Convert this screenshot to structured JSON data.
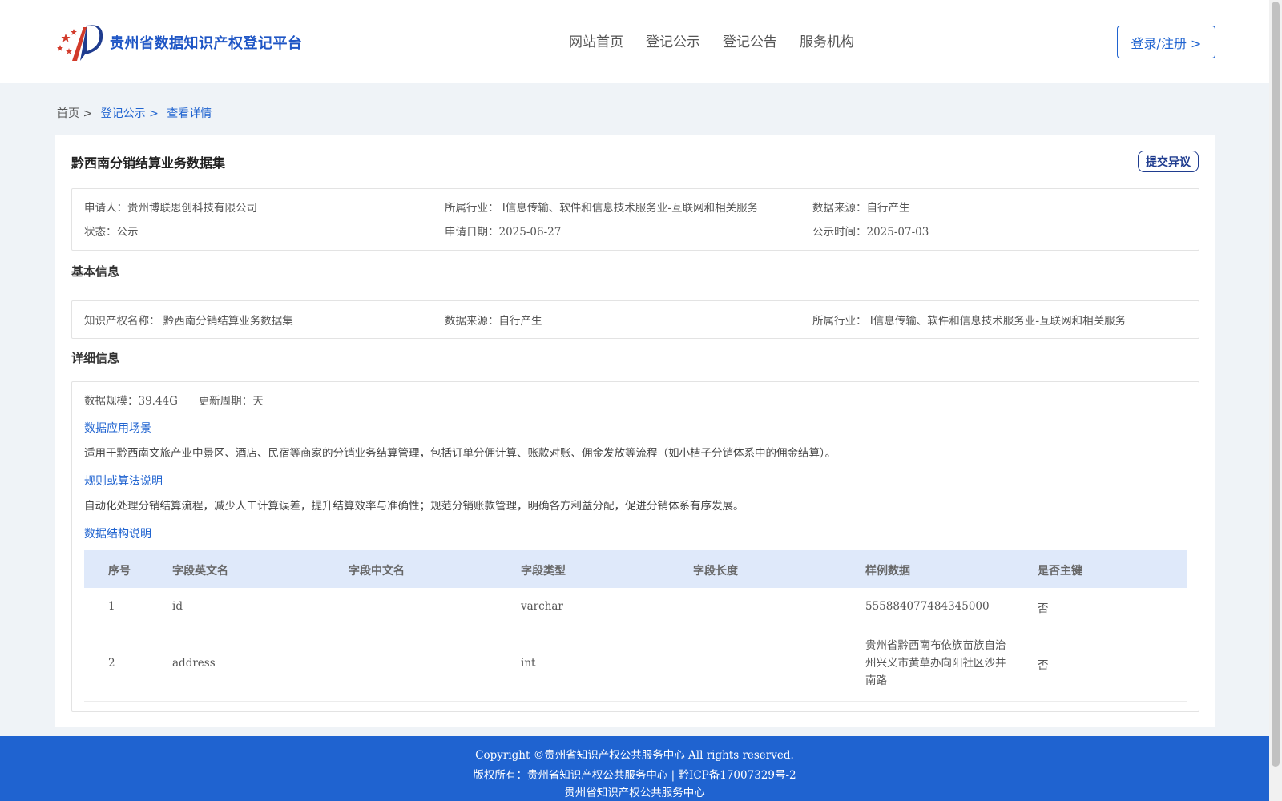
{
  "header": {
    "brand": "贵州省数据知识产权登记平台",
    "nav": [
      "网站首页",
      "登记公示",
      "登记公告",
      "服务机构"
    ],
    "login_label": "登录/注册 >"
  },
  "breadcrumb": {
    "home": "首页 >",
    "level1": "登记公示 >",
    "level2": "查看详情"
  },
  "detail": {
    "title": "黔西南分销结算业务数据集",
    "objection_label": "提交异议",
    "summary": {
      "applicant_label": "申请人：",
      "applicant": "贵州博联思创科技有限公司",
      "industry_label": "所属行业：",
      "industry": "I信息传输、软件和信息技术服务业-互联网和相关服务",
      "source_label": "数据来源：",
      "source": "自行产生",
      "status_label": "状态：",
      "status": "公示",
      "apply_date_label": "申请日期：",
      "apply_date": "2025-06-27",
      "publish_time_label": "公示时间：",
      "publish_time": "2025-07-03"
    },
    "basic": {
      "section_title": "基本信息",
      "ip_name_label": "知识产权名称：",
      "ip_name": "黔西南分销结算业务数据集",
      "source_label": "数据来源：",
      "source": "自行产生",
      "industry_label": "所属行业：",
      "industry": "I信息传输、软件和信息技术服务业-互联网和相关服务"
    },
    "details": {
      "section_title": "详细信息",
      "scale_label": "数据规模：",
      "scale": "39.44G",
      "cycle_label": "更新周期：",
      "cycle": "天",
      "scenario_title": "数据应用场景",
      "scenario_text": "适用于黔西南文旅产业中景区、酒店、民宿等商家的分销业务结算管理，包括订单分佣计算、账款对账、佣金发放等流程（如小桔子分销体系中的佣金结算）。",
      "rules_title": "规则或算法说明",
      "rules_text": "自动化处理分销结算流程，减少人工计算误差，提升结算效率与准确性；规范分销账款管理，明确各方利益分配，促进分销体系有序发展。",
      "structure_title": "数据结构说明",
      "table": {
        "headers": [
          "序号",
          "字段英文名",
          "字段中文名",
          "字段类型",
          "字段长度",
          "样例数据",
          "是否主键"
        ],
        "rows": [
          [
            "1",
            "id",
            "",
            "varchar",
            "",
            "555884077484345000",
            "否"
          ],
          [
            "2",
            "address",
            "",
            "int",
            "",
            "贵州省黔西南布依族苗族自治州兴义市黄草办向阳社区沙井南路",
            "否"
          ]
        ]
      }
    }
  },
  "footer": {
    "line1": "Copyright ©贵州省知识产权公共服务中心 All rights reserved.",
    "line2": "版权所有：贵州省知识产权公共服务中心 | 黔ICP备17007329号-2",
    "line3": "贵州省知识产权公共服务中心"
  },
  "colors": {
    "primary": "#1f63d0",
    "brand_text": "#1f56c5",
    "table_header_bg": "#dfe9fa",
    "page_bg": "#eff3f7"
  },
  "icons": {
    "logo": "stars-and-flag-logo-icon"
  }
}
